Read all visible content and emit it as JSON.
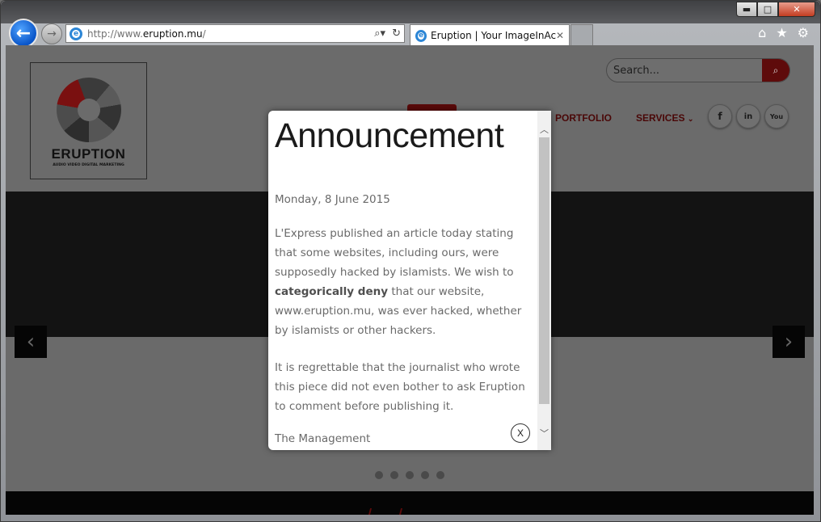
{
  "browser": {
    "url_prefix": "http://www.",
    "url_domain": "eruption.mu",
    "url_suffix": "/",
    "tab_title": "Eruption | Your ImageInActi...",
    "tab_close": "✕",
    "back_glyph": "←",
    "forward_glyph": "→",
    "window_controls": {
      "minimize": "▬",
      "maximize": "□",
      "close": "✕"
    },
    "toolbar_icons": [
      "home-icon",
      "favorites-star-icon",
      "settings-gear-icon"
    ]
  },
  "site": {
    "logo_name": "ERUPTION",
    "logo_tagline": "AUDIO VIDEO DIGITAL MARKETING",
    "search_placeholder": "Search...",
    "nav": {
      "portfolio": "PORTFOLIO",
      "services": "SERVICES"
    },
    "social": {
      "facebook": "f",
      "linkedin": "in",
      "youtube": "You"
    },
    "colors": {
      "accent": "#8b1010"
    }
  },
  "modal": {
    "title": "Announcement",
    "date": "Monday, 8 June 2015",
    "p1_before": "L'Express published an article today stating that some websites, including ours, were supposedly hacked by islamists. We wish to ",
    "p1_bold": "categorically deny",
    "p1_after": " that our website, www.eruption.mu, was ever hacked, whether by islamists or other hackers.",
    "p2": "It is regrettable that the journalist who wrote this piece did not even bother to ask Eruption to comment before publishing it.",
    "signature": "The Management",
    "close_label": "X"
  },
  "slider": {
    "dot_count": 5
  }
}
